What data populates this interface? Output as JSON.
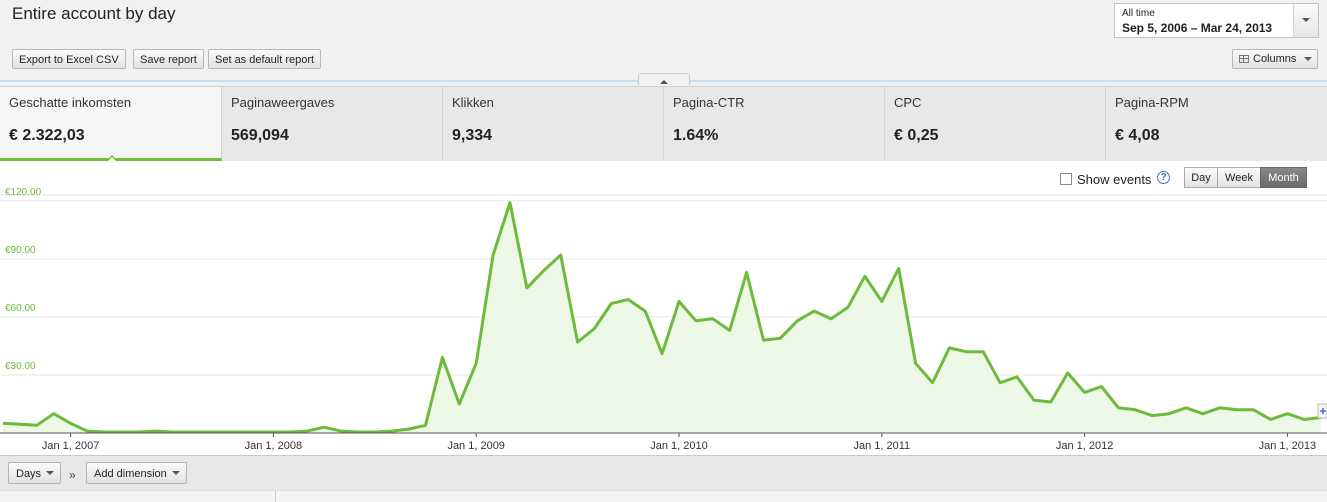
{
  "header": {
    "title": "Entire account by day"
  },
  "toolbar": {
    "export_label": "Export to Excel CSV",
    "save_label": "Save report",
    "default_label": "Set as default report",
    "columns_label": "Columns"
  },
  "date_range": {
    "label": "All time",
    "value": "Sep 5, 2006 – Mar 24, 2013"
  },
  "metrics": [
    {
      "name": "Geschatte inkomsten",
      "value": "€ 2.322,03",
      "active": true
    },
    {
      "name": "Paginaweergaves",
      "value": "569,094"
    },
    {
      "name": "Klikken",
      "value": "9,334"
    },
    {
      "name": "Pagina-CTR",
      "value": "1.64%"
    },
    {
      "name": "CPC",
      "value": "€ 0,25"
    },
    {
      "name": "Pagina-RPM",
      "value": "€ 4,08"
    }
  ],
  "chart_controls": {
    "show_events_label": "Show events",
    "help_glyph": "?",
    "granularity": [
      "Day",
      "Week",
      "Month"
    ],
    "granularity_selected": "Month"
  },
  "bottom": {
    "days_label": "Days",
    "add_dimension_label": "Add dimension",
    "separator": "»"
  },
  "colors": {
    "line": "#6cbb3c",
    "fill": "#eef8e6",
    "tick": "#6cbb3c",
    "accent": "#6fbf3c"
  },
  "chart_data": {
    "type": "area",
    "ylim": [
      0,
      123
    ],
    "yticks": [
      30,
      60,
      90,
      120
    ],
    "ytick_labels": [
      "€30.00",
      "€60.00",
      "€90.00",
      "€120.00"
    ],
    "xtick_labels": [
      "Jan 1, 2007",
      "Jan 1, 2008",
      "Jan 1, 2009",
      "Jan 1, 2010",
      "Jan 1, 2011",
      "Jan 1, 2012",
      "Jan 1, 2013"
    ],
    "x_unit": "month",
    "series": [
      {
        "values": [
          5,
          4.5,
          4,
          10,
          5,
          1,
          0.5,
          0.5,
          0.5,
          1,
          0.5,
          0.5,
          0.5,
          0.5,
          0.5,
          0.5,
          0.5,
          0.5,
          1,
          3,
          1,
          0.5,
          0.5,
          1,
          2,
          4,
          39,
          15,
          36,
          92,
          119,
          75,
          84,
          92,
          47,
          54,
          67,
          69,
          63,
          41,
          68,
          58,
          59,
          53,
          83,
          48,
          49,
          58,
          63,
          59,
          65,
          81,
          68,
          85,
          36,
          26,
          44,
          42,
          42,
          26,
          29,
          17,
          16,
          31,
          21,
          24,
          13,
          12,
          9,
          10,
          13,
          10,
          13,
          12,
          12,
          7,
          10,
          7,
          8
        ]
      }
    ]
  }
}
